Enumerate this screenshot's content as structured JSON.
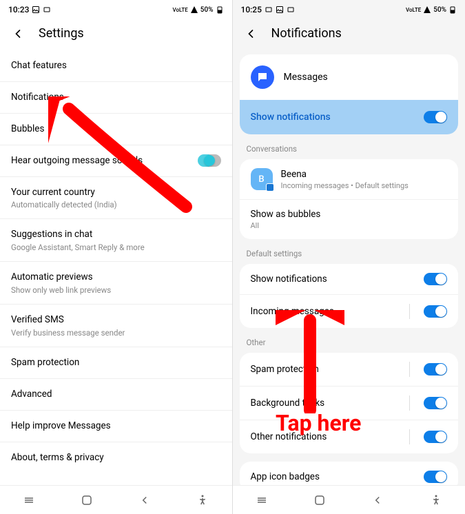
{
  "left": {
    "status": {
      "time": "10:23",
      "battery": "50%"
    },
    "header": {
      "title": "Settings"
    },
    "items": [
      {
        "title": "Chat features",
        "subtitle": ""
      },
      {
        "title": "Notifications",
        "subtitle": ""
      },
      {
        "title": "Bubbles",
        "subtitle": ""
      },
      {
        "title": "Hear outgoing message sounds",
        "subtitle": "",
        "toggle": true
      },
      {
        "title": "Your current country",
        "subtitle": "Automatically detected (India)"
      },
      {
        "title": "Suggestions in chat",
        "subtitle": "Google Assistant, Smart Reply & more"
      },
      {
        "title": "Automatic previews",
        "subtitle": "Show only web link previews"
      },
      {
        "title": "Verified SMS",
        "subtitle": "Verify business message sender"
      },
      {
        "title": "Spam protection",
        "subtitle": ""
      },
      {
        "title": "Advanced",
        "subtitle": ""
      },
      {
        "title": "Help improve Messages",
        "subtitle": ""
      },
      {
        "title": "About, terms & privacy",
        "subtitle": ""
      }
    ]
  },
  "right": {
    "status": {
      "time": "10:25",
      "battery": "50%"
    },
    "header": {
      "title": "Notifications"
    },
    "app": {
      "name": "Messages"
    },
    "highlighted": {
      "label": "Show notifications"
    },
    "sections": {
      "conversations": {
        "label": "Conversations",
        "contact": {
          "name": "Beena",
          "initial": "B",
          "subtitle": "Incoming messages • Default settings"
        },
        "bubbles": {
          "title": "Show as bubbles",
          "subtitle": "All"
        }
      },
      "defaults": {
        "label": "Default settings",
        "items": [
          {
            "title": "Show notifications"
          },
          {
            "title": "Incoming messages"
          }
        ]
      },
      "other": {
        "label": "Other",
        "items": [
          {
            "title": "Spam protection"
          },
          {
            "title": "Background tasks"
          },
          {
            "title": "Other notifications"
          }
        ]
      },
      "badges": {
        "title": "App icon badges"
      }
    }
  },
  "annotation": {
    "text": "Tap here"
  }
}
